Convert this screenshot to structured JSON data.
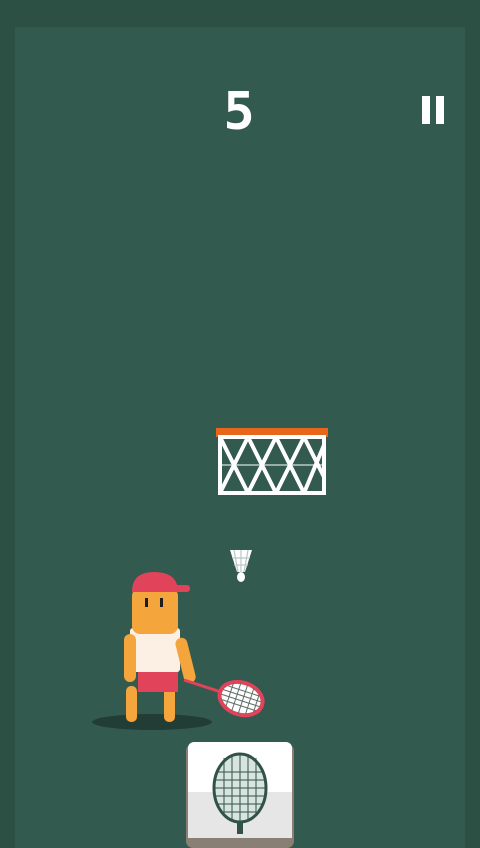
{
  "hud": {
    "score": "5",
    "pause_icon": "pause-icon"
  },
  "scene": {
    "hoop_icon": "basketball-hoop",
    "shuttlecock_icon": "shuttlecock-icon",
    "player_icon": "badminton-player",
    "swing_button_icon": "racket-icon"
  },
  "colors": {
    "background": "#2d5045",
    "court": "#325a4f",
    "hoop_rim": "#e8661c",
    "player_skin": "#f4a53c",
    "player_cap": "#e0435a",
    "score": "#ffffff"
  }
}
